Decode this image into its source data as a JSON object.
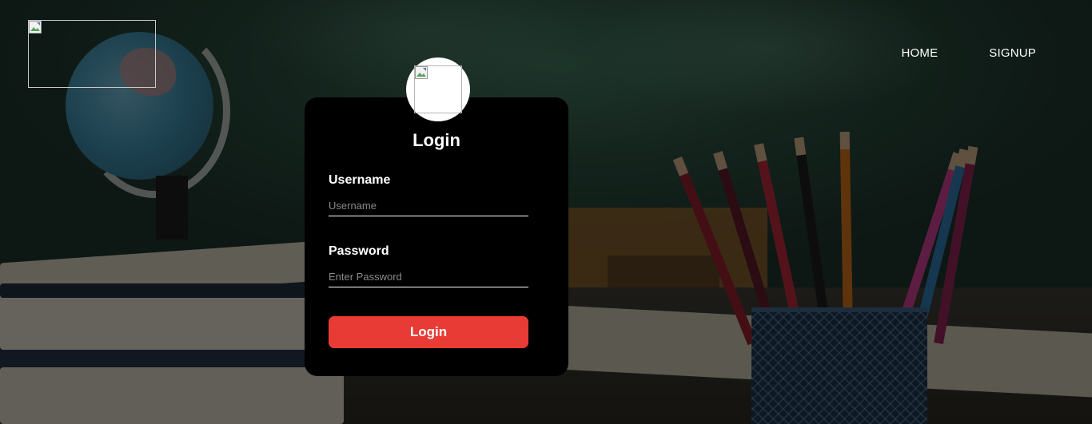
{
  "header": {
    "logo_icon": "broken-image-icon",
    "nav": {
      "home_label": "HOME",
      "signup_label": "SIGNUP"
    }
  },
  "login_card": {
    "avatar_icon": "broken-image-icon",
    "title": "Login",
    "username": {
      "label": "Username",
      "value": "",
      "placeholder": "Username"
    },
    "password": {
      "label": "Password",
      "value": "",
      "placeholder": "Enter Password"
    },
    "submit_label": "Login"
  },
  "colors": {
    "card_background": "#000000",
    "button_accent": "#e93b35",
    "text": "#ffffff",
    "placeholder": "#8a8a8a"
  }
}
